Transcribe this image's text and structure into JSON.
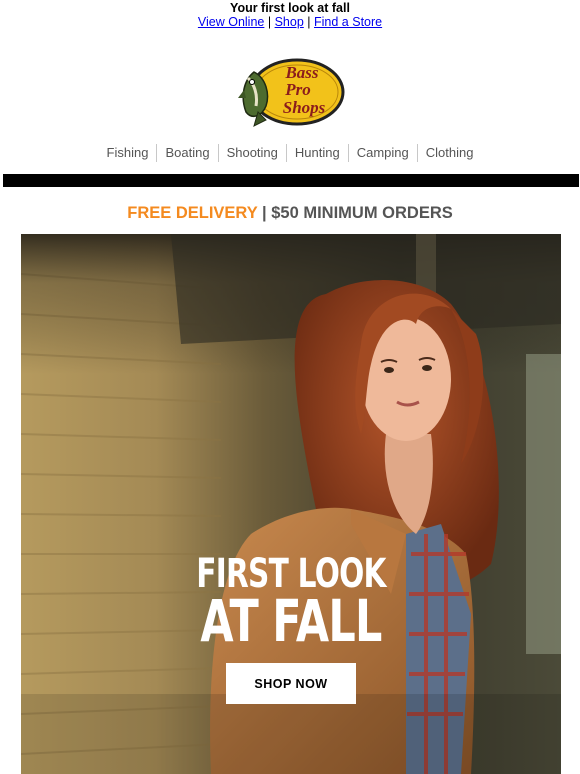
{
  "preheader": {
    "title": "Your first look at fall",
    "links": [
      "View Online",
      "Shop",
      "Find a Store"
    ],
    "separator": "|"
  },
  "logo": {
    "line1": "Bass",
    "line2": "Pro",
    "line3": "Shops",
    "colors": {
      "oval": "#f2c21a",
      "text": "#8b1c1c",
      "outline": "#222222"
    }
  },
  "nav": {
    "items": [
      "Fishing",
      "Boating",
      "Shooting",
      "Hunting",
      "Camping",
      "Clothing"
    ]
  },
  "promo": {
    "accent_text": "FREE DELIVERY",
    "rest_text": " | $50 MINIMUM ORDERS",
    "accent_color": "#f48a1f"
  },
  "hero": {
    "headline_line1": "FIRST LOOK",
    "headline_line2": "AT FALL",
    "button_label": "SHOP NOW"
  }
}
